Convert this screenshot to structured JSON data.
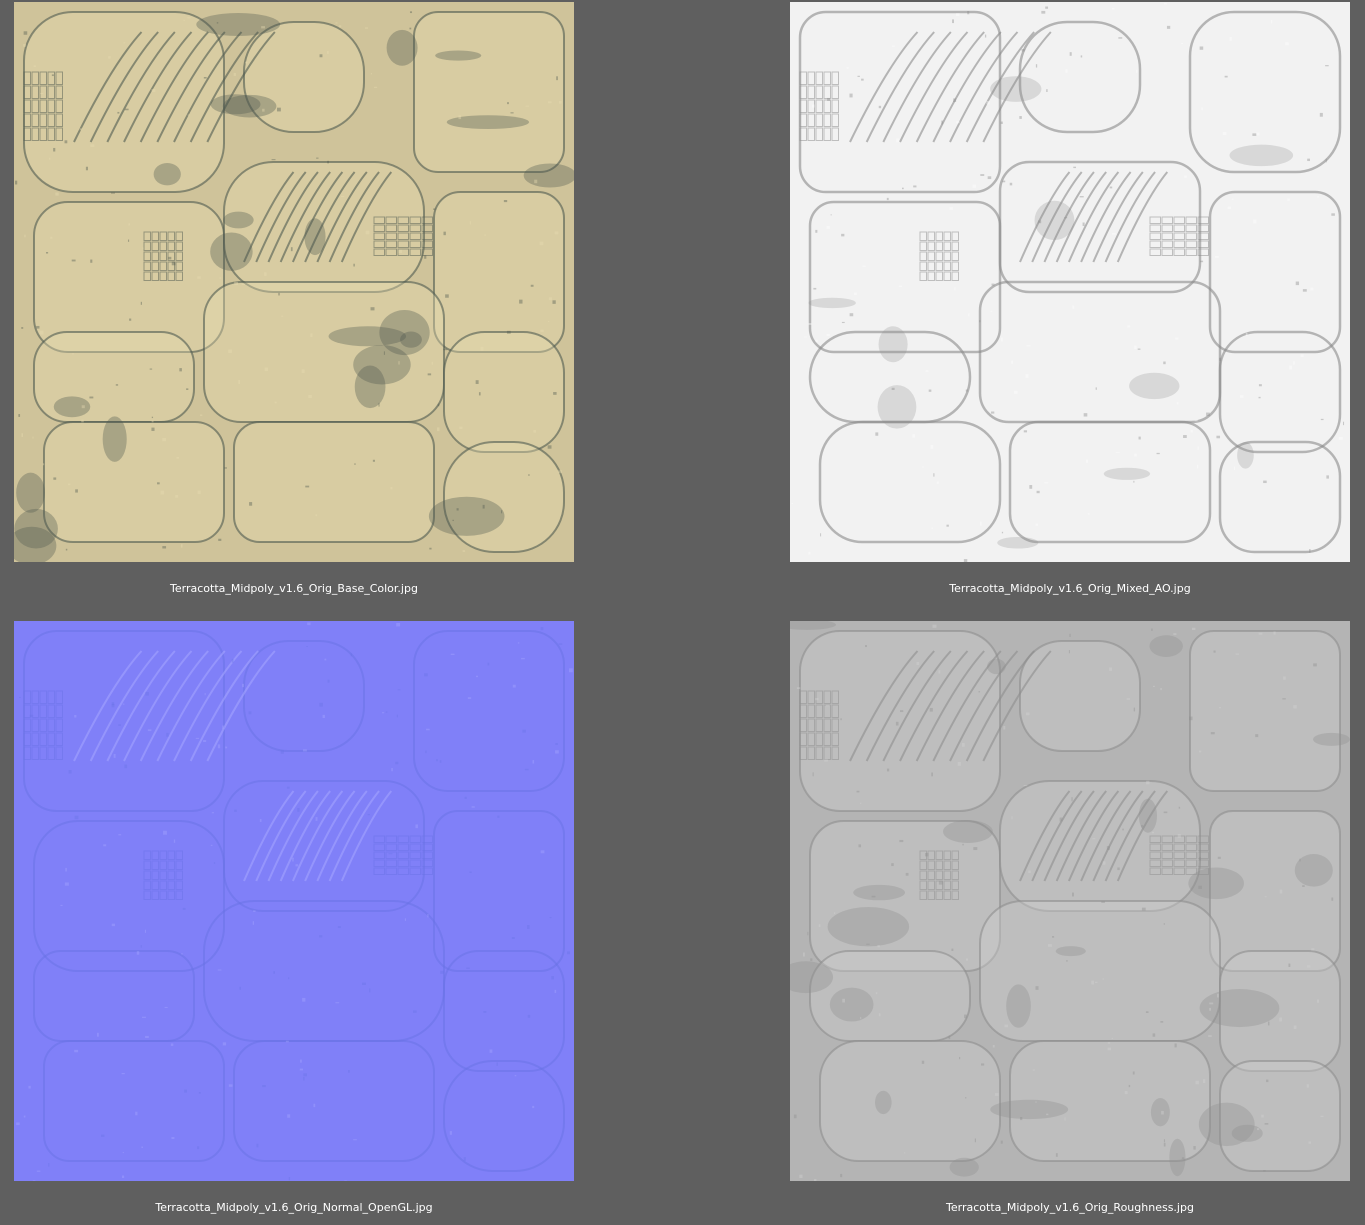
{
  "thumbnails": [
    {
      "name": "Terracotta_Midpoly_v1.6_Orig_Base_Color.jpg",
      "kind": "base-color",
      "base": "#cfc39a",
      "shade": "#4f5a50",
      "highlight": "#e8dcb2"
    },
    {
      "name": "Terracotta_Midpoly_v1.6_Orig_Mixed_AO.jpg",
      "kind": "ambient-occlusion",
      "base": "#f2f2f2",
      "shade": "#8a8a8a",
      "highlight": "#ffffff"
    },
    {
      "name": "Terracotta_Midpoly_v1.6_Orig_Normal_OpenGL.jpg",
      "kind": "normal-map",
      "base": "#8080f8",
      "shade": "#6a72e6",
      "highlight": "#a4a4ff"
    },
    {
      "name": "Terracotta_Midpoly_v1.6_Orig_Roughness.jpg",
      "kind": "roughness",
      "base": "#b4b4b4",
      "shade": "#8e8e8e",
      "highlight": "#d2d2d2"
    }
  ]
}
